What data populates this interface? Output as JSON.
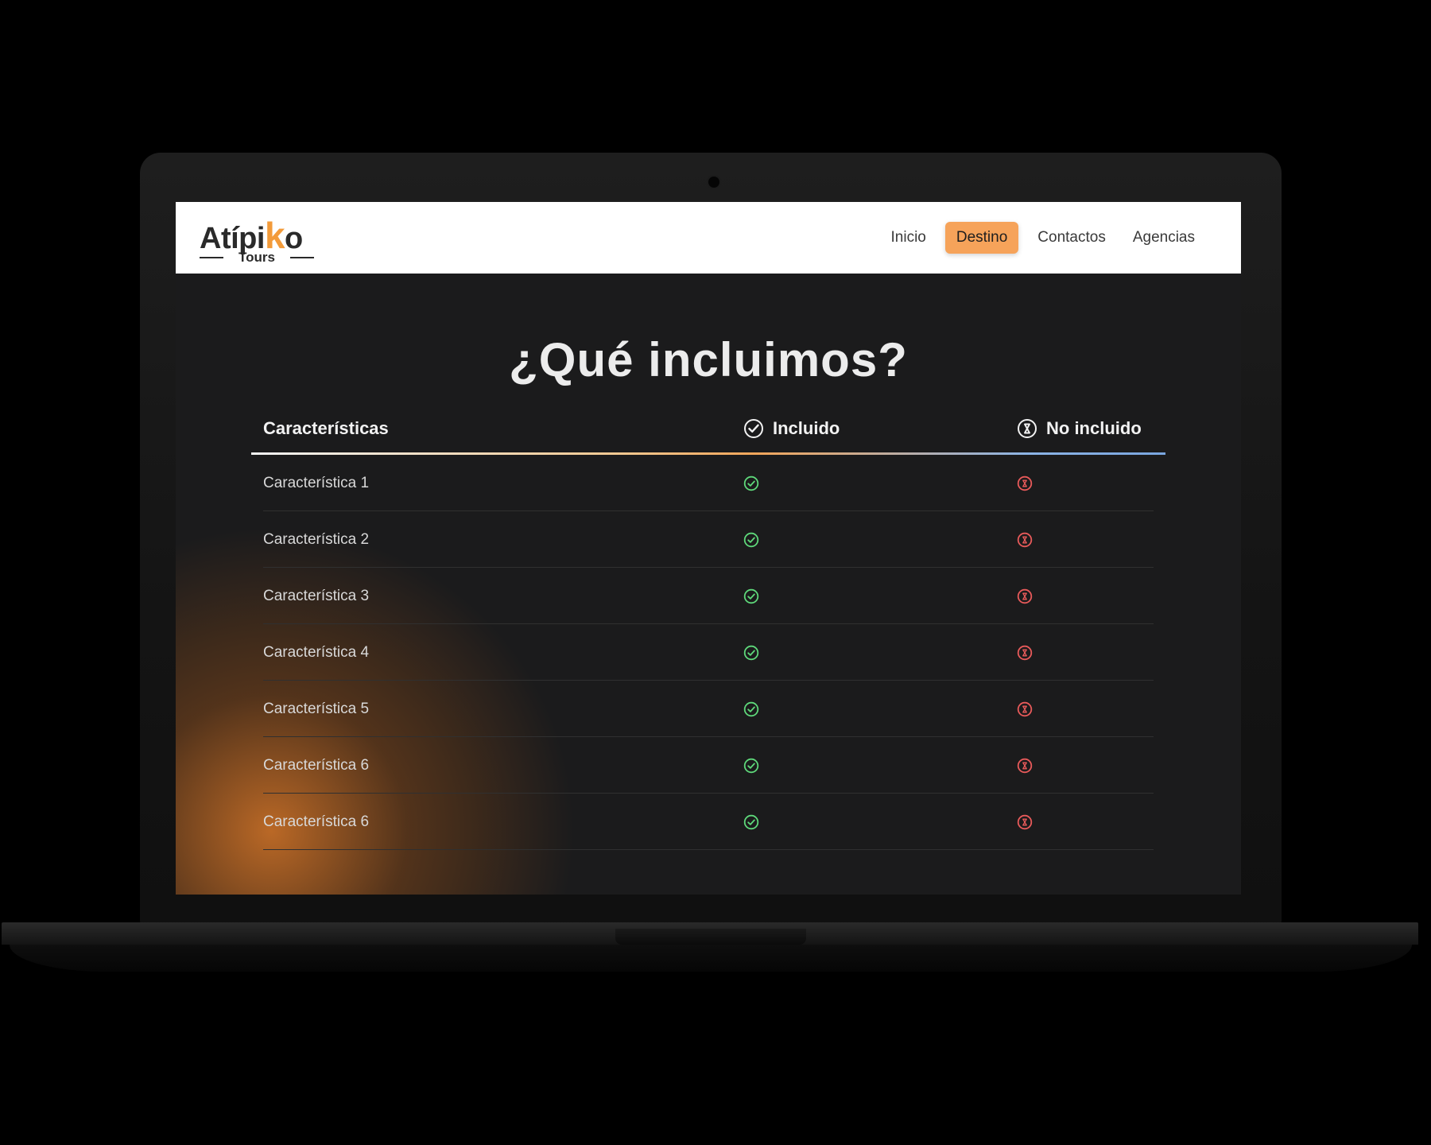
{
  "brand": {
    "logo_main_prefix": "Atípi",
    "logo_main_accent": "k",
    "logo_main_suffix": "o",
    "logo_sub": "Tours",
    "accent_color": "#f39b3a"
  },
  "nav": {
    "items": [
      {
        "label": "Inicio",
        "active": false
      },
      {
        "label": "Destino",
        "active": true
      },
      {
        "label": "Contactos",
        "active": false
      },
      {
        "label": "Agencias",
        "active": false
      }
    ]
  },
  "main": {
    "title": "¿Qué incluimos?",
    "table": {
      "headers": {
        "feature": "Características",
        "included": "Incluido",
        "not_included": "No incluido"
      },
      "rows": [
        {
          "feature": "Característica 1",
          "included": true,
          "not_included": true
        },
        {
          "feature": "Característica 2",
          "included": true,
          "not_included": true
        },
        {
          "feature": "Característica 3",
          "included": true,
          "not_included": true
        },
        {
          "feature": "Característica 4",
          "included": true,
          "not_included": true
        },
        {
          "feature": "Característica 5",
          "included": true,
          "not_included": true
        },
        {
          "feature": "Característica 6",
          "included": true,
          "not_included": true
        },
        {
          "feature": "Característica 6",
          "included": true,
          "not_included": true
        }
      ]
    }
  },
  "icons": {
    "header_included": "check-circle-icon",
    "header_not_included": "x-circle-icon",
    "row_included": "check-circle-icon",
    "row_not_included": "x-circle-icon"
  },
  "colors": {
    "included": "#5ed87a",
    "not_included": "#e85a5a",
    "page_bg": "#1b1b1c"
  }
}
